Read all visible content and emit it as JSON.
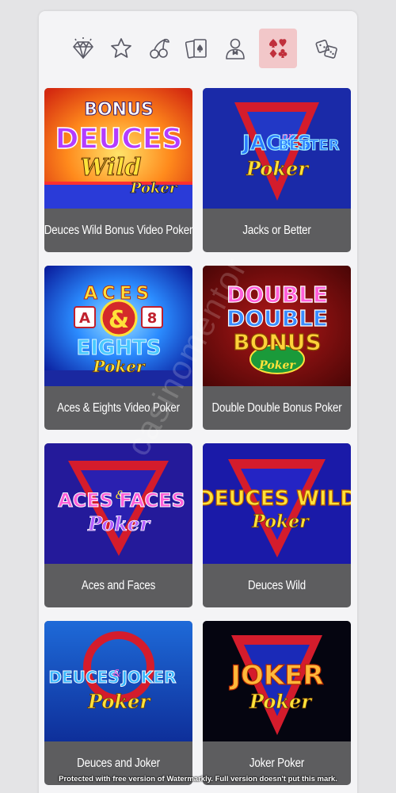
{
  "colors": {
    "page_bg": "#e4e4e6",
    "panel_bg": "#f4f4f6",
    "active_category_bg": "#f2c7c9",
    "icon_color": "#5a5a66",
    "active_icon_color": "#c0303c",
    "caption_bg": "#5d5d5f",
    "caption_text": "#ffffff"
  },
  "categories": [
    {
      "icon": "diamond-icon",
      "active": false
    },
    {
      "icon": "star-icon",
      "active": false
    },
    {
      "icon": "cherries-icon",
      "active": false
    },
    {
      "icon": "playing-cards-icon",
      "active": false
    },
    {
      "icon": "dealer-icon",
      "active": false
    },
    {
      "icon": "card-suits-icon",
      "active": true
    },
    {
      "icon": "dice-icon",
      "active": false
    }
  ],
  "games": [
    {
      "title": "Deuces Wild Bonus Video Poker",
      "art": [
        "BONUS",
        "DEUCES",
        "Wild",
        "Poker"
      ]
    },
    {
      "title": "Jacks or Better",
      "art": [
        "JACKS",
        "or",
        "BETTER",
        "Poker"
      ]
    },
    {
      "title": "Aces & Eights Video Poker",
      "art": [
        "ACES",
        "A",
        "&",
        "8",
        "EIGHTS",
        "Poker"
      ]
    },
    {
      "title": "Double Double Bonus Poker",
      "art": [
        "DOUBLE",
        "DOUBLE",
        "BONUS",
        "Poker"
      ]
    },
    {
      "title": "Aces and Faces",
      "art": [
        "ACES",
        "&",
        "FACES",
        "Poker"
      ]
    },
    {
      "title": "Deuces Wild",
      "art": [
        "DEUCES WILD",
        "Poker"
      ]
    },
    {
      "title": "Deuces and Joker",
      "art": [
        "DEUCES",
        "&",
        "JOKER",
        "Poker"
      ]
    },
    {
      "title": "Joker Poker",
      "art": [
        "JOKER",
        "Poker"
      ]
    }
  ],
  "watermark": {
    "footer_text": "Protected with free version of Watermarkly. Full version doesn't put this mark.",
    "diagonal_text": "casinomentor"
  }
}
